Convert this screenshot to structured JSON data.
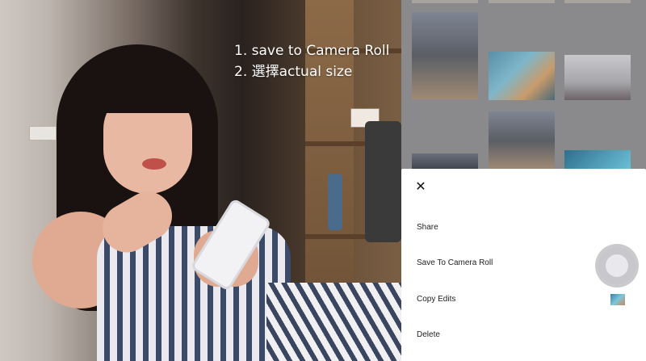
{
  "overlay": {
    "step_1": "1. save to Camera Roll",
    "step_2": "2. 選擇actual size"
  },
  "action_sheet": {
    "close_icon": "✕",
    "items": [
      {
        "label": "Share"
      },
      {
        "label": "Save To Camera Roll"
      },
      {
        "label": "Copy Edits"
      },
      {
        "label": "Delete"
      }
    ]
  },
  "icons": {
    "close": "close-icon",
    "assistive_touch": "assistive-touch-icon",
    "copy_edits_preview": "image-thumbnail-icon"
  },
  "colors": {
    "sheet_background": "#ffffff",
    "grid_dim_background": "#8a8a8c",
    "overlay_text": "#ffffff"
  }
}
